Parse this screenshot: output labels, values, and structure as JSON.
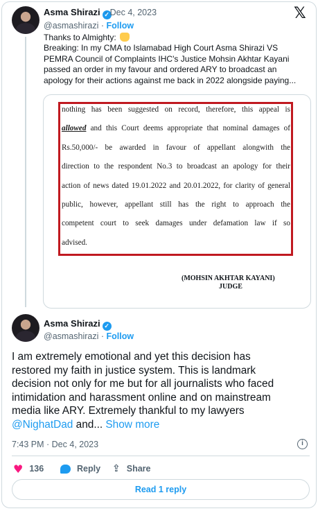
{
  "quoted_tweet": {
    "author_name": "Asma Shirazi",
    "date": "· Dec 4, 2023",
    "handle": "@asmashirazi",
    "follow_label": "Follow",
    "text_lines": [
      "Thanks to Almighty: ",
      "Breaking: In my CMA to Islamabad High Court Asma Shirazi VS",
      "PEMRA Council of Complaints IHC's Justice Mohsin Akhtar Kayani",
      "passed an order in my favour and ordered ARY to broadcast an",
      "apology for their actions against me back in 2022 alongside paying..."
    ],
    "document": {
      "lines": [
        "nothing has been suggested on record, therefore, this appeal is",
        "allowed",
        " and this Court deems appropriate that nominal damages of",
        "Rs.50,000/- be awarded in favour of appellant alongwith the",
        "direction to the respondent No.3 to broadcast an apology for their",
        "action of news dated 19.01.2022 and 20.01.2022, for clarity of general",
        "public, however, appellant still has the right to approach the",
        "competent court to seek damages under defamation law if so",
        "advised."
      ],
      "judge_name": "(MOHSIN AKHTAR KAYANI)",
      "judge_title": "JUDGE"
    }
  },
  "main_tweet": {
    "author_name": "Asma Shirazi",
    "handle": "@asmashirazi",
    "separator": " · ",
    "follow_label": "Follow",
    "text_lines": [
      "I am extremely emotional and yet this decision has",
      "restored my faith in justice system. This is landmark",
      "decision not only for me but for all journalists who faced",
      "intimidation and harassment online and on mainstream",
      "media like ARY. Extremely thankful to my lawyers"
    ],
    "mention": "@NighatDad",
    "after_mention": " and... ",
    "show_more": "Show more",
    "timestamp": "7:43 PM · Dec 4, 2023"
  },
  "actions": {
    "like_count": "136",
    "reply_label": "Reply",
    "share_label": "Share"
  },
  "read_reply_label": "Read 1 reply",
  "icons": {
    "logo": "x-logo-icon",
    "verified": "verified-badge-icon",
    "like": "heart-icon",
    "reply": "reply-bubble-icon",
    "share": "share-icon",
    "info": "info-icon"
  },
  "colors": {
    "accent": "#1d9bf0",
    "like": "#f91880",
    "document_frame": "#c01920"
  }
}
